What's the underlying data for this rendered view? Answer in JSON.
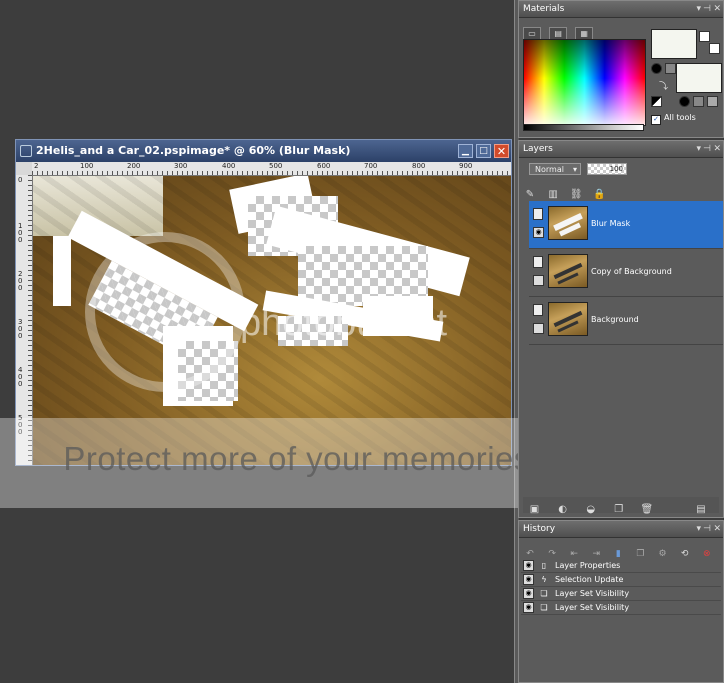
{
  "document": {
    "title": "2Helis_and a Car_02.pspimage* @  60% (Blur Mask)",
    "ruler_h": [
      "2",
      "100",
      "200",
      "300",
      "400",
      "500",
      "600",
      "700",
      "800",
      "900"
    ],
    "ruler_v": [
      "0",
      "100",
      "200",
      "300",
      "400",
      "500"
    ]
  },
  "watermark": {
    "logo": "photobucket",
    "tagline": "Protect more of your memories for less!"
  },
  "materials": {
    "title": "Materials",
    "all_tools_label": "All tools",
    "all_tools_checked": true,
    "foreground_color": "#f4f6ef",
    "background_color": "#f4f6ef"
  },
  "layers": {
    "title": "Layers",
    "blend_mode": "Normal",
    "opacity": "100",
    "items": [
      {
        "name": "Blur Mask",
        "selected": true
      },
      {
        "name": "Copy of Background",
        "selected": false
      },
      {
        "name": "Background",
        "selected": false
      }
    ]
  },
  "history": {
    "title": "History",
    "items": [
      {
        "label": "Layer Properties",
        "icon": "page-icon"
      },
      {
        "label": "Selection Update",
        "icon": "lightning-icon"
      },
      {
        "label": "Layer Set Visibility",
        "icon": "layers-icon"
      },
      {
        "label": "Layer Set Visibility",
        "icon": "layers-icon"
      }
    ]
  }
}
